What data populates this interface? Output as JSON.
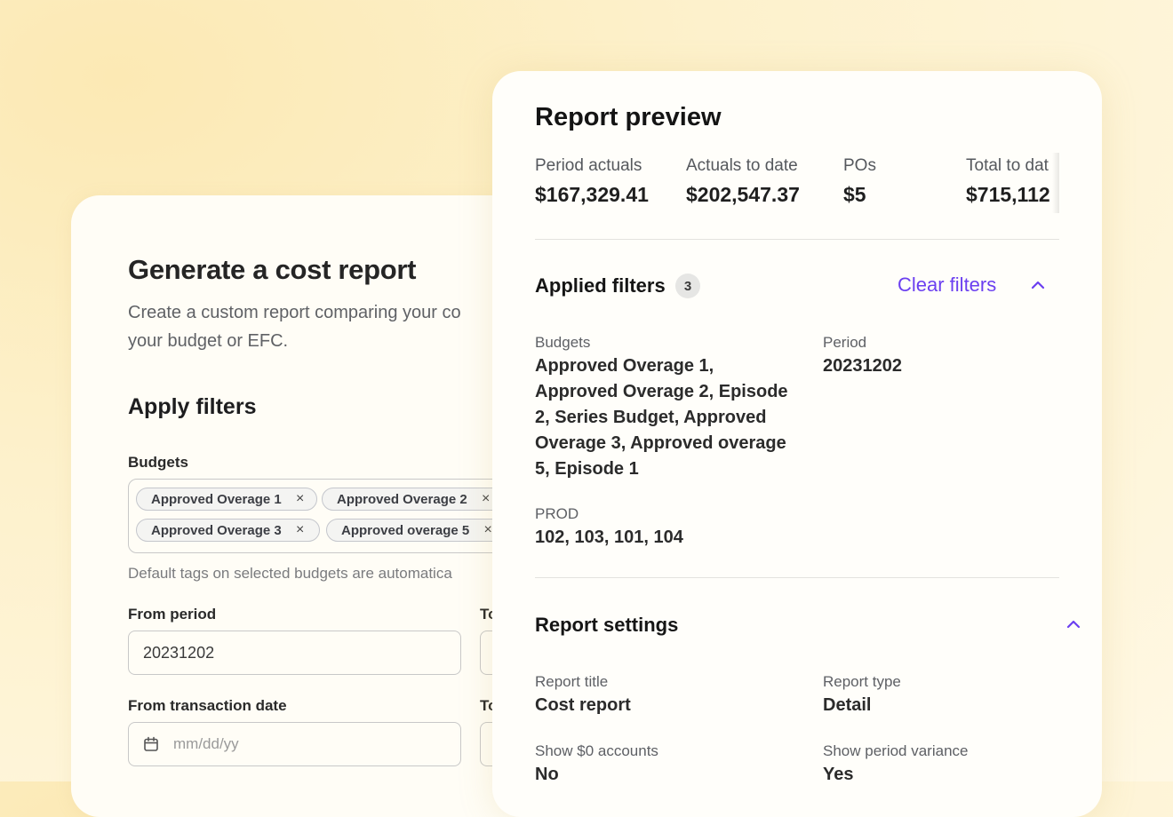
{
  "left": {
    "title": "Generate a cost report",
    "description": "Create a custom report comparing your co your budget or EFC.",
    "desc_line1": "Create a custom report comparing your co",
    "desc_line2": "your budget or EFC.",
    "apply_filters": "Apply filters",
    "budgets_label": "Budgets",
    "tags": [
      "Approved Overage 1",
      "Approved Overage 2",
      "Approved Overage 3",
      "Approved overage 5"
    ],
    "tag_remove_glyph": "×",
    "hint": "Default tags on selected budgets are automatica",
    "from_period_label": "From period",
    "from_period_value": "20231202",
    "to_period_label_cut": "To",
    "from_date_label": "From transaction date",
    "from_date_placeholder": "mm/dd/yy",
    "to_date_label_cut": "To"
  },
  "preview": {
    "title": "Report preview",
    "metrics": [
      {
        "label": "Period actuals",
        "value": "$167,329.41"
      },
      {
        "label": "Actuals to date",
        "value": "$202,547.37"
      },
      {
        "label": "POs",
        "value": "$5"
      },
      {
        "label": "Total to dat",
        "value": "$715,112"
      }
    ],
    "applied_filters": {
      "title": "Applied filters",
      "count": "3",
      "clear_label": "Clear filters",
      "budgets_label": "Budgets",
      "budgets_lines": [
        "Approved Overage 1,",
        "Approved Overage 2, Episode",
        "2, Series Budget, Approved",
        "Overage 3, Approved overage",
        "5, Episode 1"
      ],
      "period_label": "Period",
      "period_value": "20231202",
      "prod_label": "PROD",
      "prod_value": "102, 103, 101, 104"
    },
    "report_settings": {
      "title": "Report settings",
      "report_title_label": "Report title",
      "report_title_value": "Cost report",
      "report_type_label": "Report type",
      "report_type_value": "Detail",
      "show_zero_label": "Show $0 accounts",
      "show_zero_value": "No",
      "show_variance_label": "Show period variance",
      "show_variance_value": "Yes"
    }
  },
  "colors": {
    "accent": "#6b3ff0",
    "background": "#fdf3cf"
  },
  "icons": [
    "close-icon",
    "calendar-icon",
    "chevron-up-icon"
  ]
}
